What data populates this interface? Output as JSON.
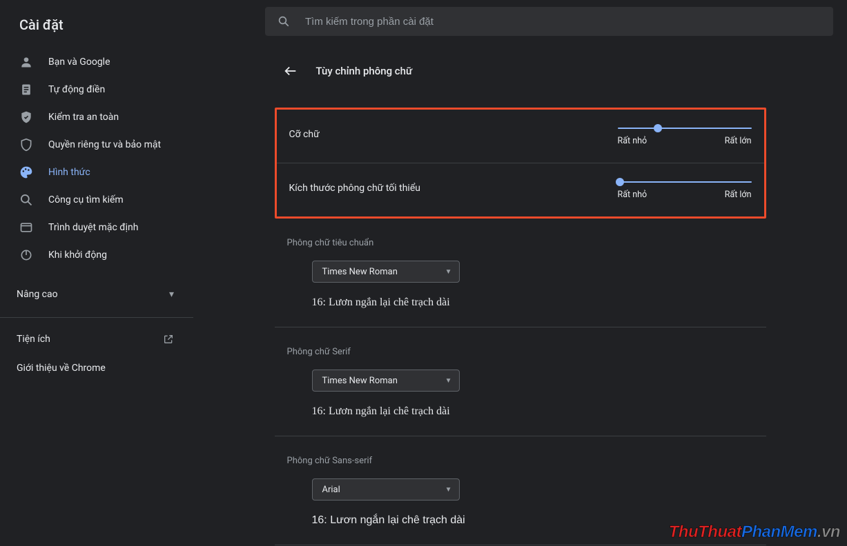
{
  "app_title": "Cài đặt",
  "search": {
    "placeholder": "Tìm kiếm trong phần cài đặt"
  },
  "sidebar": {
    "items": [
      {
        "label": "Bạn và Google",
        "icon": "person"
      },
      {
        "label": "Tự động điền",
        "icon": "autofill"
      },
      {
        "label": "Kiểm tra an toàn",
        "icon": "safety"
      },
      {
        "label": "Quyền riêng tư và bảo mật",
        "icon": "shield"
      },
      {
        "label": "Hình thức",
        "icon": "palette",
        "active": true
      },
      {
        "label": "Công cụ tìm kiếm",
        "icon": "search"
      },
      {
        "label": "Trình duyệt mặc định",
        "icon": "browser"
      },
      {
        "label": "Khi khởi động",
        "icon": "power"
      }
    ],
    "advanced": "Nâng cao",
    "extensions": "Tiện ích",
    "about": "Giới thiệu về Chrome"
  },
  "page": {
    "title": "Tùy chỉnh phông chữ",
    "sliders": {
      "font_size": {
        "label": "Cỡ chữ",
        "min_label": "Rất nhỏ",
        "max_label": "Rất lớn",
        "value_pct": 30
      },
      "min_font_size": {
        "label": "Kích thước phông chữ tối thiểu",
        "min_label": "Rất nhỏ",
        "max_label": "Rất lớn",
        "value_pct": 2
      }
    },
    "fonts": {
      "standard": {
        "section_label": "Phông chữ tiêu chuẩn",
        "selected": "Times New Roman",
        "sample": "16: Lươn ngắn lại chê trạch dài"
      },
      "serif": {
        "section_label": "Phông chữ Serif",
        "selected": "Times New Roman",
        "sample": "16: Lươn ngắn lại chê trạch dài"
      },
      "sans": {
        "section_label": "Phông chữ Sans-serif",
        "selected": "Arial",
        "sample": "16: Lươn ngắn lại chê trạch dài"
      }
    }
  },
  "watermark": {
    "a": "ThuThuat",
    "b": "PhanMem",
    "c": ".vn"
  }
}
